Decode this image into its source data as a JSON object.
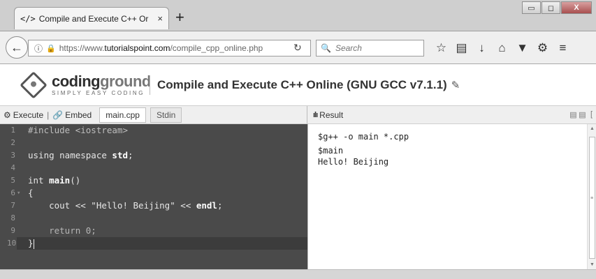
{
  "browser": {
    "tab": {
      "icon": "</>",
      "title": "Compile and Execute C++ Or",
      "close": "×"
    },
    "new_tab": "+",
    "window_buttons": {
      "minimize": "▭",
      "maximize": "◻",
      "close": "X"
    },
    "url": {
      "scheme_prefix": "https://www.",
      "host": "tutorialspoint.com",
      "path": "/compile_cpp_online.php"
    },
    "search_placeholder": "Search",
    "nav_icons": [
      "star-icon",
      "reading-list-icon",
      "download-icon",
      "home-icon",
      "pocket-icon",
      "extension-icon",
      "menu-icon"
    ]
  },
  "site": {
    "logo": {
      "word_main": "coding",
      "word_tail": "ground",
      "tagline": "SIMPLY EASY CODING"
    },
    "title": "Compile and Execute C++ Online (GNU GCC v7.1.1)"
  },
  "toolbar": {
    "execute": "Execute",
    "separator": "|",
    "embed": "Embed",
    "tabs": [
      {
        "label": "main.cpp",
        "active": true
      },
      {
        "label": "Stdin",
        "active": false
      }
    ]
  },
  "result": {
    "label": "Result",
    "lines": [
      "$g++ -o main *.cpp",
      "$main",
      "Hello! Beijing"
    ]
  },
  "editor": {
    "line_numbers": [
      "1",
      "2",
      "3",
      "4",
      "5",
      "6",
      "7",
      "8",
      "9",
      "10"
    ],
    "fold_marker_line": "6",
    "active_line": "10",
    "lines": [
      {
        "pre": "#include <iostream>"
      },
      {
        "pre": ""
      },
      {
        "pre": "using namespace ",
        "kw": "std",
        "post": ";"
      },
      {
        "pre": ""
      },
      {
        "pre": "int ",
        "kw": "main",
        "post": "()"
      },
      {
        "pre": "{"
      },
      {
        "pre": "    cout << \"Hello! Beijing\" << ",
        "kw": "endl",
        "post": ";"
      },
      {
        "pre": ""
      },
      {
        "pre": "    return 0;"
      },
      {
        "pre": "}"
      }
    ]
  },
  "colors": {
    "editor_bg": "#4a4a4a",
    "chrome_bg": "#cfcfcf",
    "toolbar_bg": "#efefef"
  }
}
